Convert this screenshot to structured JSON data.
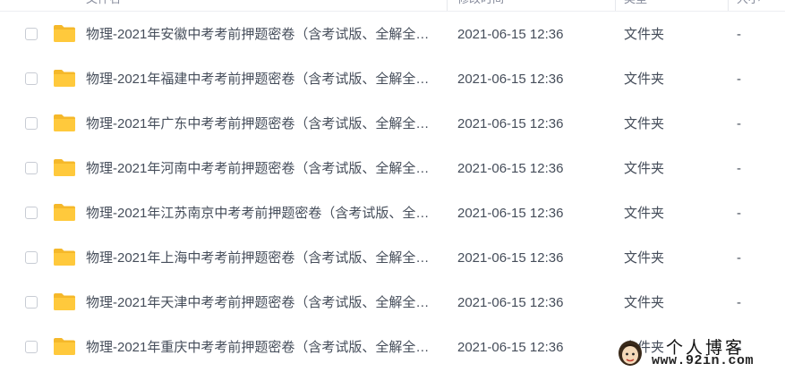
{
  "colors": {
    "folder": "#ffc93c",
    "folder_back": "#f5b82a",
    "text": "#454d5a",
    "checkbox_border": "#c8ccd4",
    "divider": "#eceef2"
  },
  "header": {
    "col_name": "文件名",
    "col_time": "修改时间",
    "col_type": "类型",
    "col_size": "大小"
  },
  "rows": [
    {
      "name": "物理-2021年安徽中考考前押题密卷（含考试版、全解全…",
      "time": "2021-06-15 12:36",
      "type": "文件夹",
      "size": "-",
      "icon": "folder-icon"
    },
    {
      "name": "物理-2021年福建中考考前押题密卷（含考试版、全解全…",
      "time": "2021-06-15 12:36",
      "type": "文件夹",
      "size": "-",
      "icon": "folder-icon"
    },
    {
      "name": "物理-2021年广东中考考前押题密卷（含考试版、全解全…",
      "time": "2021-06-15 12:36",
      "type": "文件夹",
      "size": "-",
      "icon": "folder-icon"
    },
    {
      "name": "物理-2021年河南中考考前押题密卷（含考试版、全解全…",
      "time": "2021-06-15 12:36",
      "type": "文件夹",
      "size": "-",
      "icon": "folder-icon"
    },
    {
      "name": "物理-2021年江苏南京中考考前押题密卷（含考试版、全…",
      "time": "2021-06-15 12:36",
      "type": "文件夹",
      "size": "-",
      "icon": "folder-icon"
    },
    {
      "name": "物理-2021年上海中考考前押题密卷（含考试版、全解全…",
      "time": "2021-06-15 12:36",
      "type": "文件夹",
      "size": "-",
      "icon": "folder-icon"
    },
    {
      "name": "物理-2021年天津中考考前押题密卷（含考试版、全解全…",
      "time": "2021-06-15 12:36",
      "type": "文件夹",
      "size": "-",
      "icon": "folder-icon"
    },
    {
      "name": "物理-2021年重庆中考考前押题密卷（含考试版、全解全…",
      "time": "2021-06-15 12:36",
      "type": "文件夹",
      "size": "-",
      "icon": "folder-icon"
    }
  ],
  "watermark": {
    "title": "个人博客",
    "url": "www.92in.com",
    "icon": "avatar-icon"
  }
}
